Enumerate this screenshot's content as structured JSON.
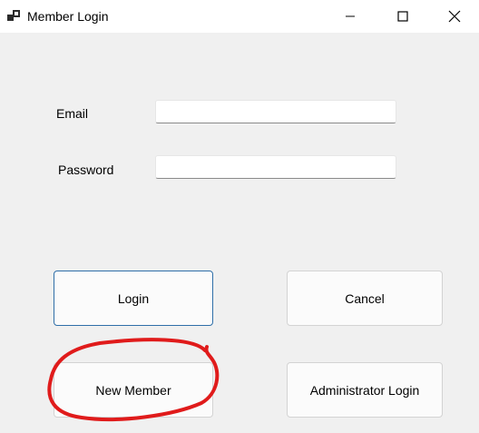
{
  "window": {
    "title": "Member Login",
    "icon": "app-window-icon",
    "controls": [
      "minimize-icon",
      "maximize-icon",
      "close-icon"
    ]
  },
  "form": {
    "email_label": "Email",
    "email_value": "",
    "password_label": "Password",
    "password_value": ""
  },
  "buttons": {
    "login": "Login",
    "cancel": "Cancel",
    "new_member": "New Member",
    "admin_login": "Administrator Login"
  },
  "annotation": {
    "type": "hand-drawn circle",
    "target": "new-member-button",
    "color": "#e01b1b"
  },
  "colors": {
    "window_bg": "#f0f0f0",
    "titlebar_bg": "#ffffff",
    "focus_border": "#2f6fa8",
    "annotation": "#e01b1b"
  }
}
